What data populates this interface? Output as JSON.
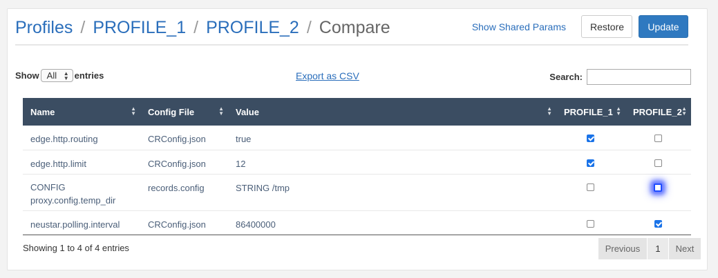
{
  "breadcrumb": {
    "items": [
      "Profiles",
      "PROFILE_1",
      "PROFILE_2"
    ],
    "current": "Compare",
    "separator": "/"
  },
  "actions": {
    "shared_params": "Show Shared Params",
    "restore": "Restore",
    "update": "Update"
  },
  "controls": {
    "show_label": "Show",
    "entries_value": "All",
    "entries_label": "entries",
    "export_label": "Export as CSV",
    "search_label": "Search:",
    "search_value": ""
  },
  "table": {
    "columns": [
      "Name",
      "Config File",
      "Value",
      "PROFILE_1",
      "PROFILE_2"
    ],
    "rows": [
      {
        "name": "edge.http.routing",
        "file": "CRConfig.json",
        "value": "true",
        "p1": true,
        "p2": false
      },
      {
        "name": "edge.http.limit",
        "file": "CRConfig.json",
        "value": "12",
        "p1": true,
        "p2": false
      },
      {
        "name": "CONFIG proxy.config.temp_dir",
        "file": "records.config",
        "value": "STRING /tmp",
        "p1": false,
        "p2": false,
        "p2_focused": true
      },
      {
        "name": "neustar.polling.interval",
        "file": "CRConfig.json",
        "value": "86400000",
        "p1": false,
        "p2": true
      }
    ]
  },
  "footer": {
    "info": "Showing 1 to 4 of 4 entries",
    "previous": "Previous",
    "page": "1",
    "next": "Next"
  },
  "colors": {
    "link": "#2a6ebb",
    "table_header": "#3b4d62",
    "primary_button": "#2f79c0",
    "checkbox_checked": "#1a73e8"
  }
}
